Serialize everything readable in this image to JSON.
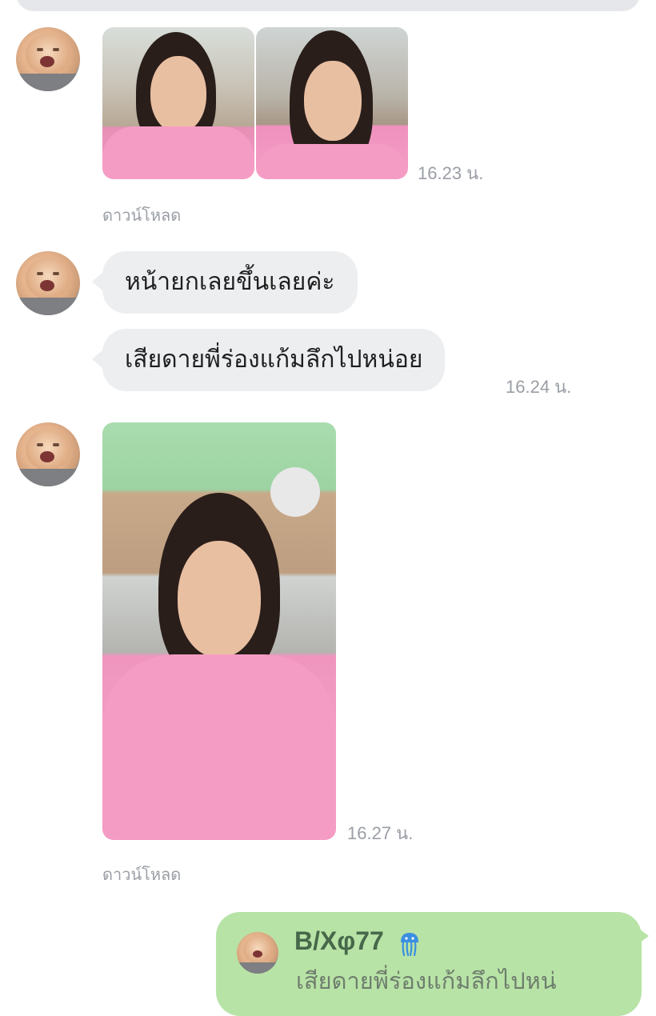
{
  "messages": {
    "m1": {
      "time": "16.23 น.",
      "download": "ดาวน์โหลด"
    },
    "m2": {
      "text_1": "หน้ายกเลยขึ้นเลยค่ะ",
      "text_2": "เสียดายพี่ร่องแก้มลึกไปหน่อย",
      "time": "16.24 น."
    },
    "m3": {
      "time": "16.27 น.",
      "download": "ดาวน์โหลด"
    }
  },
  "reply": {
    "name": "B/Xφ77",
    "icon": "jellyfish-icon",
    "text": "เสียดายพี่ร่องแก้มลึกไปหน่"
  },
  "colors": {
    "incoming_bubble": "#edeef0",
    "outgoing_bubble": "#b8e3a6",
    "timestamp": "#9a9ea5",
    "reply_name": "#47684a",
    "badge": "#3b8fe0"
  }
}
